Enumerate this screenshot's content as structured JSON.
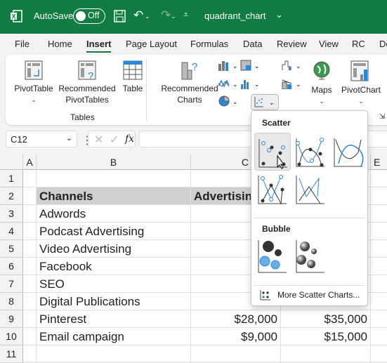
{
  "titlebar": {
    "autosave_label": "AutoSave",
    "autosave_state": "Off",
    "filename": "quadrant_chart",
    "brand_color": "#107c41"
  },
  "tabs": [
    "File",
    "Home",
    "Insert",
    "Page Layout",
    "Formulas",
    "Data",
    "Review",
    "View",
    "RC",
    "De"
  ],
  "active_tab": "Insert",
  "ribbon": {
    "pivottable": "PivotTable",
    "recommended_pivottables_1": "Recommended",
    "recommended_pivottables_2": "PivotTables",
    "table": "Table",
    "group_tables": "Tables",
    "recommended_charts_1": "Recommended",
    "recommended_charts_2": "Charts",
    "maps": "Maps",
    "pivotchart": "PivotChart"
  },
  "formula_bar": {
    "name_box": "C12",
    "fx": "fx",
    "value": ""
  },
  "columns": [
    "A",
    "B",
    "C",
    "E"
  ],
  "rows": [
    "1",
    "2",
    "3",
    "4",
    "5",
    "6",
    "7",
    "8",
    "9",
    "10",
    "11"
  ],
  "sheet": {
    "headers": [
      "Channels",
      "Advertisin"
    ],
    "channels": [
      "Adwords",
      "Podcast Advertising",
      "Video Advertising",
      "Facebook",
      "SEO",
      "Digital Publications",
      "Pinterest",
      "Email campaign"
    ],
    "row9": {
      "c": "$28,000",
      "d": "$35,000"
    },
    "row10": {
      "c": "$9,000",
      "d": "$15,000"
    }
  },
  "scatter_menu": {
    "section_scatter": "Scatter",
    "section_bubble": "Bubble",
    "more": "More Scatter Charts..."
  }
}
